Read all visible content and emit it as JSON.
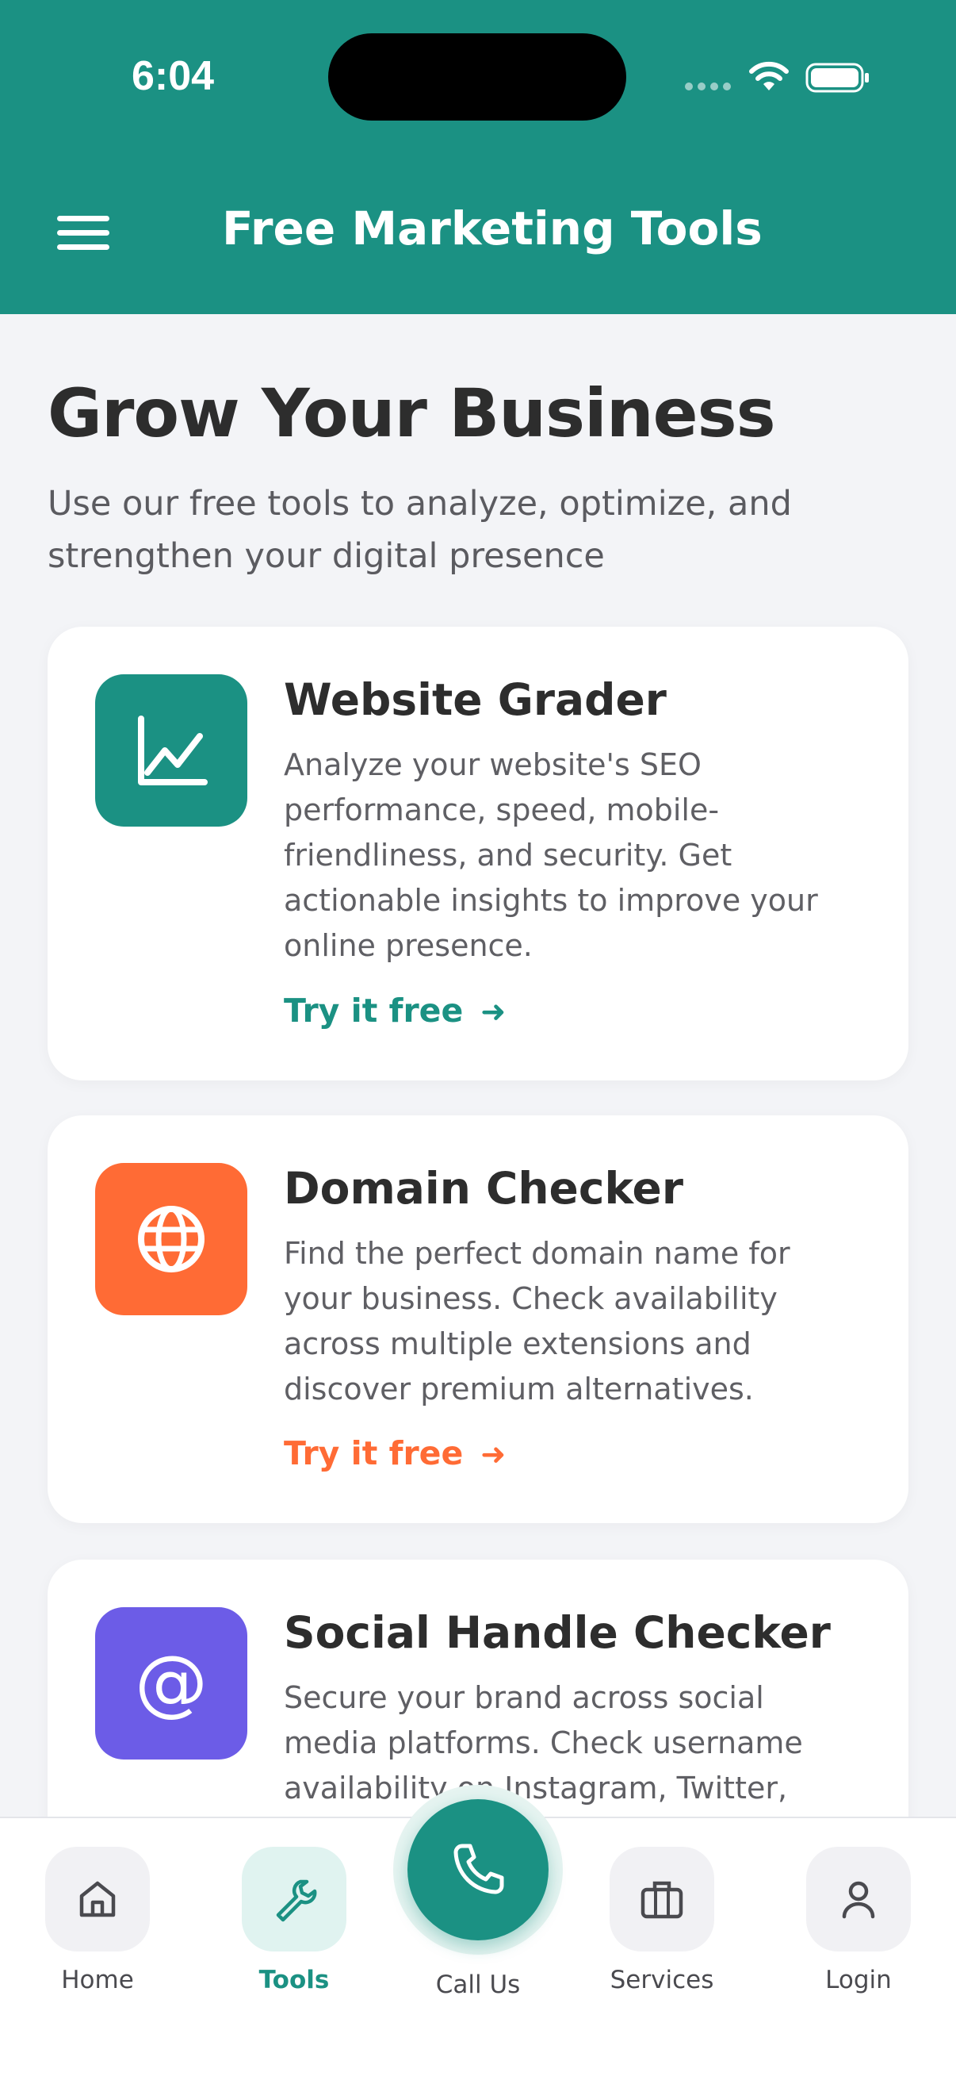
{
  "status_bar": {
    "time": "6:04"
  },
  "header": {
    "title": "Free Marketing Tools",
    "background_color": "#1b9183"
  },
  "hero": {
    "title": "Grow Your Business",
    "subtitle": "Use our free tools to analyze, optimize, and strengthen your digital presence"
  },
  "tools": [
    {
      "title": "Website Grader",
      "description": "Analyze your website's SEO performance, speed, mobile-friendliness, and security. Get actionable insights to improve your online presence.",
      "cta": "Try it free",
      "icon": "line-chart-icon",
      "color": "#1b9183"
    },
    {
      "title": "Domain Checker",
      "description": "Find the perfect domain name for your business. Check availability across multiple extensions and discover premium alternatives.",
      "cta": "Try it free",
      "icon": "globe-icon",
      "color": "#ff6b35"
    },
    {
      "title": "Social Handle Checker",
      "description": "Secure your brand across social media platforms. Check username availability on Instagram, Twitter,",
      "icon": "at-sign-icon",
      "color": "#6c5ce7"
    }
  ],
  "bottom_nav": {
    "items": [
      {
        "label": "Home",
        "icon": "home-icon"
      },
      {
        "label": "Tools",
        "icon": "wrench-icon",
        "active": true
      },
      {
        "label": "Services",
        "icon": "briefcase-icon"
      },
      {
        "label": "Login",
        "icon": "user-icon"
      }
    ],
    "call": {
      "label": "Call Us",
      "icon": "phone-icon"
    }
  }
}
